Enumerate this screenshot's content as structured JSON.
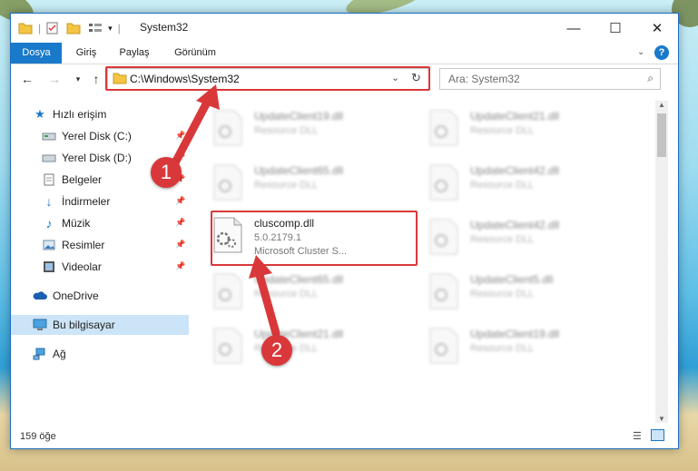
{
  "window": {
    "title": "System32",
    "minimize": "—",
    "maximize": "☐",
    "close": "✕",
    "help": "?"
  },
  "ribbon": {
    "tabs": [
      "Dosya",
      "Giriş",
      "Paylaş",
      "Görünüm"
    ]
  },
  "address": {
    "path": "C:\\Windows\\System32",
    "search_placeholder": "Ara: System32"
  },
  "sidebar": {
    "items": [
      {
        "label": "Hızlı erişim",
        "icon": "star-icon"
      },
      {
        "label": "Yerel Disk (C:)",
        "icon": "drive-icon"
      },
      {
        "label": "Yerel Disk (D:)",
        "icon": "drive-icon"
      },
      {
        "label": "Belgeler",
        "icon": "documents-icon"
      },
      {
        "label": "İndirmeler",
        "icon": "download-icon"
      },
      {
        "label": "Müzik",
        "icon": "music-icon"
      },
      {
        "label": "Resimler",
        "icon": "pictures-icon"
      },
      {
        "label": "Videolar",
        "icon": "video-icon"
      },
      {
        "label": "OneDrive",
        "icon": "cloud-icon"
      },
      {
        "label": "Bu bilgisayar",
        "icon": "computer-icon"
      },
      {
        "label": "Ağ",
        "icon": "network-icon"
      }
    ]
  },
  "files": {
    "left": [
      {
        "name": "UpdateClient19.dll",
        "desc": "Resource DLL"
      },
      {
        "name": "UpdateClient65.dll",
        "desc": "Resource DLL"
      },
      {
        "name": "cluscomp.dll",
        "version": "5.0.2179.1",
        "desc": "Microsoft Cluster S..."
      },
      {
        "name": "UpdateClient65.dll",
        "desc": "Resource DLL"
      },
      {
        "name": "UpdateClient21.dll",
        "desc": "Resource DLL"
      }
    ],
    "right": [
      {
        "name": "UpdateClient21.dll",
        "desc": "Resource DLL"
      },
      {
        "name": "UpdateClient42.dll",
        "desc": "Resource DLL"
      },
      {
        "name": "UpdateClient42.dll",
        "desc": "Resource DLL"
      },
      {
        "name": "UpdateClient5.dll",
        "desc": "Resource DLL"
      },
      {
        "name": "UpdateClient19.dll",
        "desc": "Resource DLL"
      }
    ]
  },
  "annotations": {
    "step1": "1",
    "step2": "2"
  },
  "status": {
    "count": "159 öğe"
  },
  "colors": {
    "accent": "#1979ca",
    "highlight": "#d9383a",
    "selected": "#cce4f7"
  }
}
